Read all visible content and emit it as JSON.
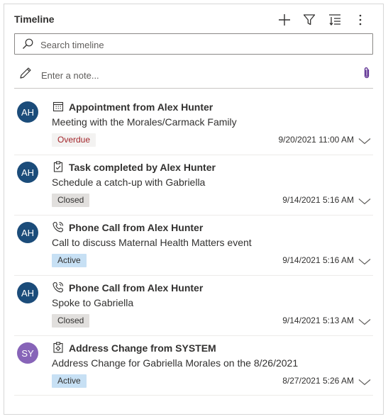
{
  "timeline": {
    "title": "Timeline",
    "search_placeholder": "Search timeline",
    "note_placeholder": "Enter a note...",
    "accent": "#0078d4",
    "items": [
      {
        "avatar": "AH",
        "avatar_color": "#1b4c7a",
        "icon": "calendar-icon",
        "title": "Appointment from Alex Hunter",
        "subtitle": "Meeting with the Morales/Carmack Family",
        "status": "Overdue",
        "date": "9/20/2021 11:00 AM"
      },
      {
        "avatar": "AH",
        "avatar_color": "#1b4c7a",
        "icon": "task-icon",
        "title": "Task completed by Alex Hunter",
        "subtitle": "Schedule a catch-up with Gabriella",
        "status": "Closed",
        "date": "9/14/2021 5:16 AM"
      },
      {
        "avatar": "AH",
        "avatar_color": "#1b4c7a",
        "icon": "phone-icon",
        "title": "Phone Call from Alex Hunter",
        "subtitle": "Call to discuss Maternal Health Matters event",
        "status": "Active",
        "date": "9/14/2021 5:16 AM"
      },
      {
        "avatar": "AH",
        "avatar_color": "#1b4c7a",
        "icon": "phone-icon",
        "title": "Phone Call from Alex Hunter",
        "subtitle": "Spoke to Gabriella",
        "status": "Closed",
        "date": "9/14/2021 5:13 AM"
      },
      {
        "avatar": "SY",
        "avatar_color": "#8764b8",
        "icon": "system-icon",
        "title": "Address Change from SYSTEM",
        "subtitle": "Address Change for Gabriella Morales on the 8/26/2021",
        "status": "Active",
        "date": "8/27/2021 5:26 AM"
      }
    ]
  }
}
